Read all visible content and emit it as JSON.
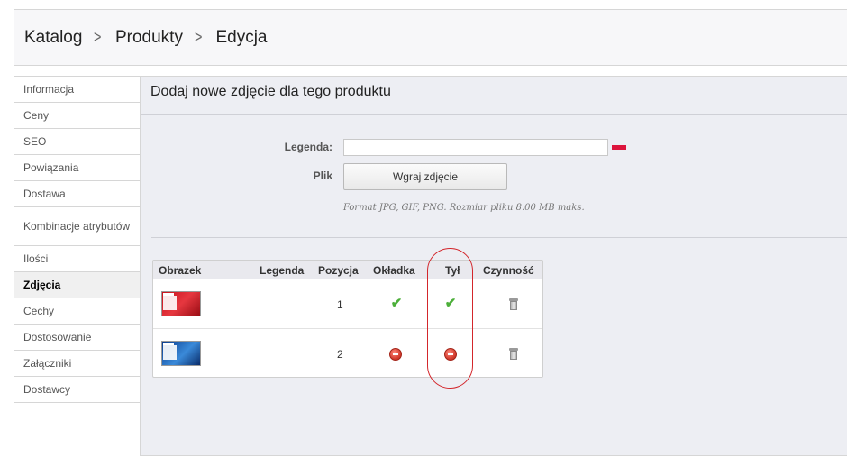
{
  "breadcrumb": {
    "items": [
      "Katalog",
      "Produkty",
      "Edycja"
    ],
    "separator": ">"
  },
  "sidebar": {
    "items": [
      {
        "label": "Informacja"
      },
      {
        "label": "Ceny"
      },
      {
        "label": "SEO"
      },
      {
        "label": "Powiązania"
      },
      {
        "label": "Dostawa"
      },
      {
        "label": "Kombinacje atrybutów"
      },
      {
        "label": "Ilości"
      },
      {
        "label": "Zdjęcia",
        "active": true
      },
      {
        "label": "Cechy"
      },
      {
        "label": "Dostosowanie"
      },
      {
        "label": "Załączniki"
      },
      {
        "label": "Dostawcy"
      }
    ]
  },
  "main": {
    "title": "Dodaj nowe zdjęcie dla tego produktu",
    "form": {
      "legend_label": "Legenda:",
      "legend_value": "",
      "file_label": "Plik",
      "upload_button": "Wgraj zdjęcie",
      "hint": "Format JPG, GIF, PNG. Rozmiar pliku 8.00 MB maks."
    },
    "table": {
      "headers": [
        "Obrazek",
        "Legenda",
        "Pozycja",
        "Okładka",
        "Tył",
        "Czynność"
      ],
      "rows": [
        {
          "position": "1",
          "cover": "check-icon",
          "back": "check-icon",
          "action": "trash-icon"
        },
        {
          "position": "2",
          "cover": "minus-circle-icon",
          "back": "minus-circle-icon",
          "action": "trash-icon"
        }
      ]
    }
  },
  "colors": {
    "accent_red": "#d3262b",
    "check_green": "#4caf3a",
    "panel_bg": "#edeef3"
  }
}
